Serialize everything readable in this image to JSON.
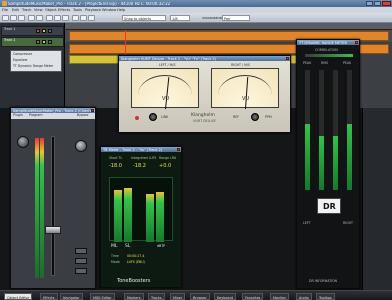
{
  "app": {
    "title": "SamplitudeMusicMaker_Pro - Track 2 - [ProjectEnd.vip] - 44100 Hz L: 00:00:32:22"
  },
  "menu": [
    "File",
    "Edit",
    "Track",
    "View",
    "Object",
    "Effects",
    "Tools",
    "Playback",
    "Window",
    "Help"
  ],
  "toolbar": {
    "snap_label": "Snap to objects",
    "zoom_label": "1/8",
    "vis_label": "Visualization",
    "vis_value": "Pan"
  },
  "tracks": [
    {
      "name": "Track 1"
    },
    {
      "name": "Track 2"
    },
    {
      "name": "Compressor"
    },
    {
      "name": "Equalizer"
    },
    {
      "name": "TT Dynamic Range Meter"
    }
  ],
  "vu_window": {
    "title": "Klanghelm VUMT Deluxe - Track 2 - \"Vu\" \"Fx\" (Track 2)",
    "left_label": "LEFT / M/S",
    "right_label": "RIGHT / M/S",
    "brand": "Klanghelm",
    "brand_sub": "VUMT DELUXE",
    "controls": [
      "LINK",
      "REF",
      "PPM",
      "LINK"
    ]
  },
  "channel_window": {
    "title": "SamplitudeMusicMaker_Pro - Track 2 (Channel)",
    "plugin_label": "Plugin",
    "program_label": "Program",
    "bypass_label": "Bypass"
  },
  "booster_window": {
    "title": "TB Meter - Track 2 - \"Vu\" (Track 2)",
    "short_label": "Short TL",
    "integrated_label": "Integrated LUFS",
    "range_label": "Range LRA",
    "short_value": "-18.0",
    "integrated_value": "-18.2",
    "range_value": "+0.0",
    "ml_label": "ML",
    "sl_label": "SL",
    "dbtp_label": "dBTP",
    "time_label": "Time",
    "time_value": "00:00:27.4",
    "mode_label": "Mode",
    "mode_value": "LUFS (EBU)",
    "brand": "ToneBoosters"
  },
  "dr_window": {
    "title": "TT DYNAMIC RANGE METER",
    "correlation_label": "CORRELATION",
    "peak_label": "PEAK",
    "rms_label": "RMS",
    "dr_label": "DR",
    "left_label": "LEFT",
    "right_label": "RIGHT",
    "footer": "DR INFORMATION"
  },
  "taskbar": {
    "tabs": [
      "Object Editor",
      "Effects",
      "Navigator",
      "MIDI Editor",
      "Markers",
      "Tracks",
      "Mixer",
      "Browser",
      "Keyboard",
      "Favorites",
      "Monitor",
      "Audio",
      "Toolbox"
    ]
  },
  "colors": {
    "accent_orange": "#e0852b",
    "clip_yellow": "#d4c338",
    "meter_green": "#33c24a",
    "meter_red": "#e03a2f"
  }
}
